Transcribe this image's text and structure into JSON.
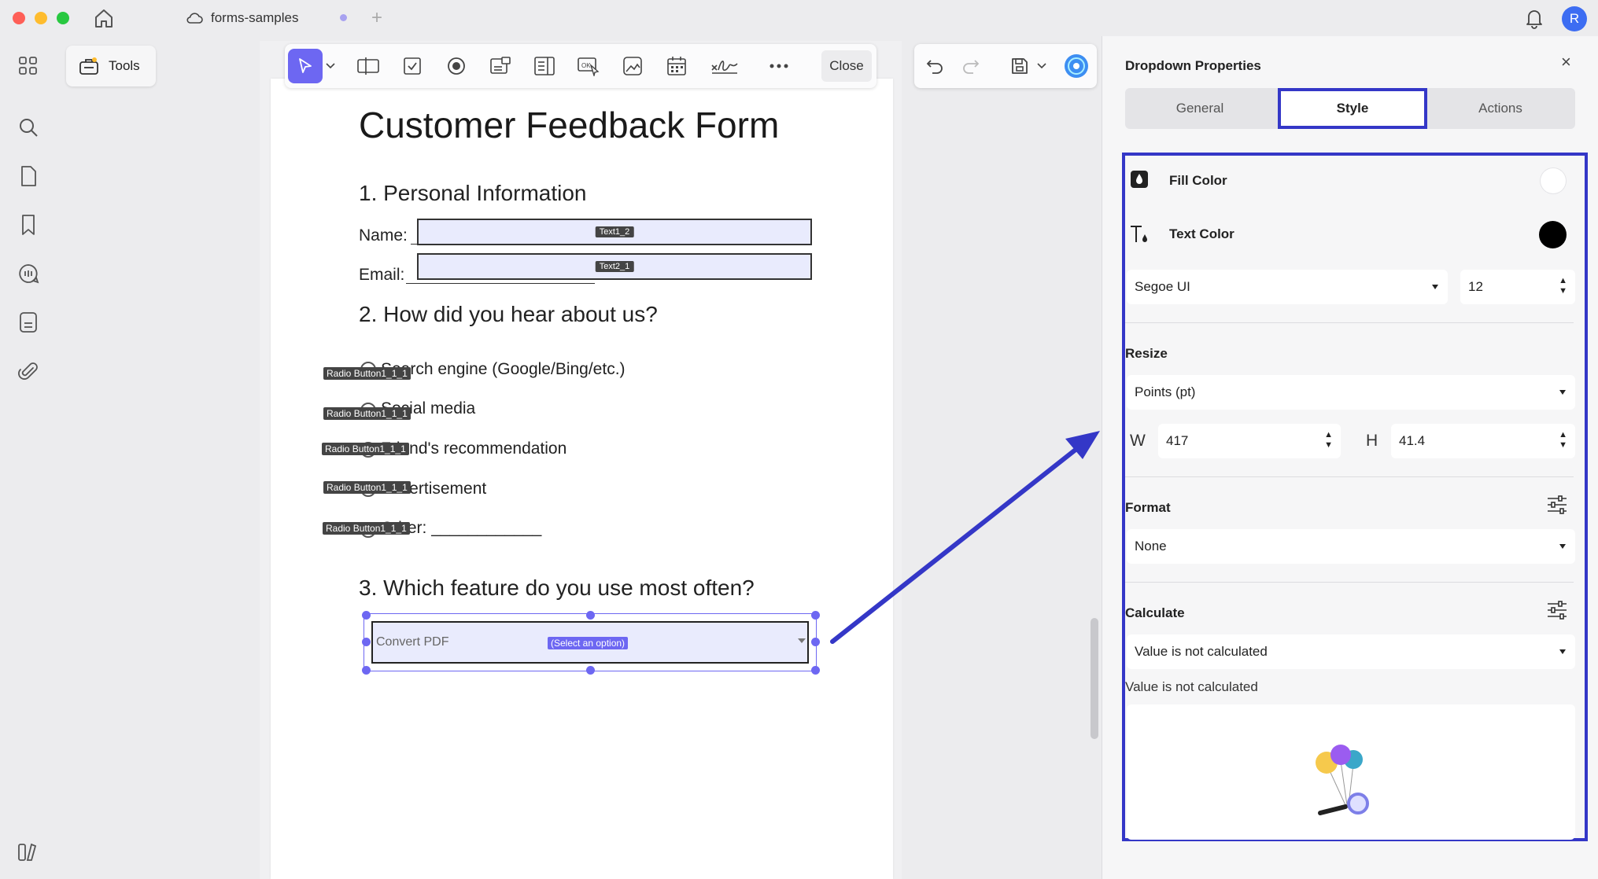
{
  "app": {
    "tab_name": "forms-samples",
    "avatar_letter": "R"
  },
  "tools": {
    "label": "Tools"
  },
  "toolbar": {
    "close_label": "Close"
  },
  "form": {
    "title": "Customer Feedback Form",
    "section1": "1. Personal Information",
    "name_label": "Name:",
    "name_field_tag": "Text1_2",
    "email_label": "Email:",
    "email_field_tag": "Text2_1",
    "section2": "2. How did you hear about us?",
    "options": [
      {
        "text": "Search engine (Google/Bing/etc.)",
        "tag": "Radio Button1_1_1"
      },
      {
        "text": "Social media",
        "tag": "Radio Button1_1_1"
      },
      {
        "text": "Friend's recommendation",
        "tag": "Radio Button1_1_1"
      },
      {
        "text": "Advertisement",
        "tag": "Radio Button1_1_1"
      },
      {
        "text": "Other: ____________",
        "tag": "Radio Button1_1_1"
      }
    ],
    "section3": "3. Which feature do you use most often?",
    "dropdown_value": "Convert PDF",
    "dropdown_tag": "(Select an option)"
  },
  "panel": {
    "title": "Dropdown Properties",
    "tabs": [
      "General",
      "Style",
      "Actions"
    ],
    "active_tab": "Style",
    "fill_color_label": "Fill Color",
    "fill_color": "#ffffff",
    "text_color_label": "Text Color",
    "text_color": "#000000",
    "font": "Segoe UI",
    "font_size": "12",
    "resize_label": "Resize",
    "unit": "Points (pt)",
    "w_label": "W",
    "w_value": "417",
    "h_label": "H",
    "h_value": "41.4",
    "format_label": "Format",
    "format_value": "None",
    "calculate_label": "Calculate",
    "calculate_value": "Value is not calculated",
    "calculate_note": "Value is not calculated"
  },
  "colors": {
    "accent": "#6d67f2",
    "highlight": "#3437c7"
  }
}
